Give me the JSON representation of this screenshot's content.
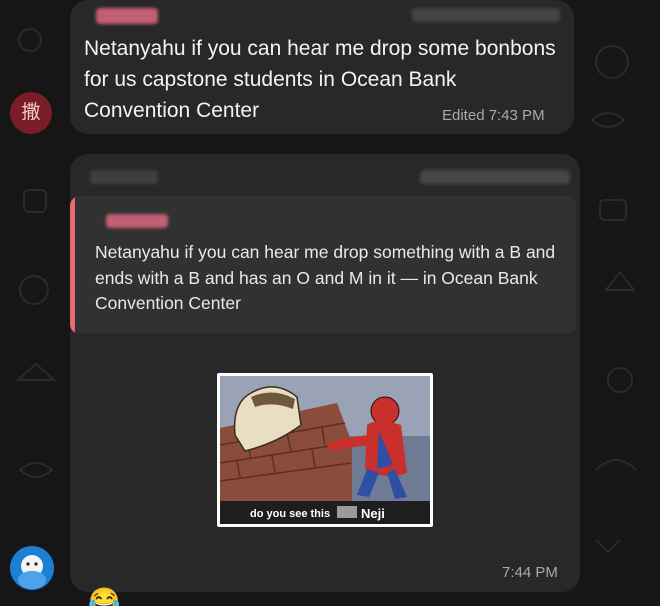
{
  "chat": {
    "messages": [
      {
        "avatar_text": "撒",
        "text": "Netanyahu if you can hear me drop some bonbons for us capstone students in Ocean Bank Convention Center",
        "status": "Edited 7:43 PM"
      },
      {
        "reply_quote": "Netanyahu if you can hear me drop something with a B and ends with a B and has an O and M in it — in Ocean Bank Convention Center",
        "meme_caption_left": "do you see this",
        "meme_caption_right": "Neji",
        "time": "7:44 PM"
      }
    ],
    "reaction_emoji": "😂"
  },
  "colors": {
    "background": "#161616",
    "bubble": "#282828",
    "quote": "#313131",
    "quote_accent": "#e46a74",
    "timestamp": "#a9a9a9"
  }
}
